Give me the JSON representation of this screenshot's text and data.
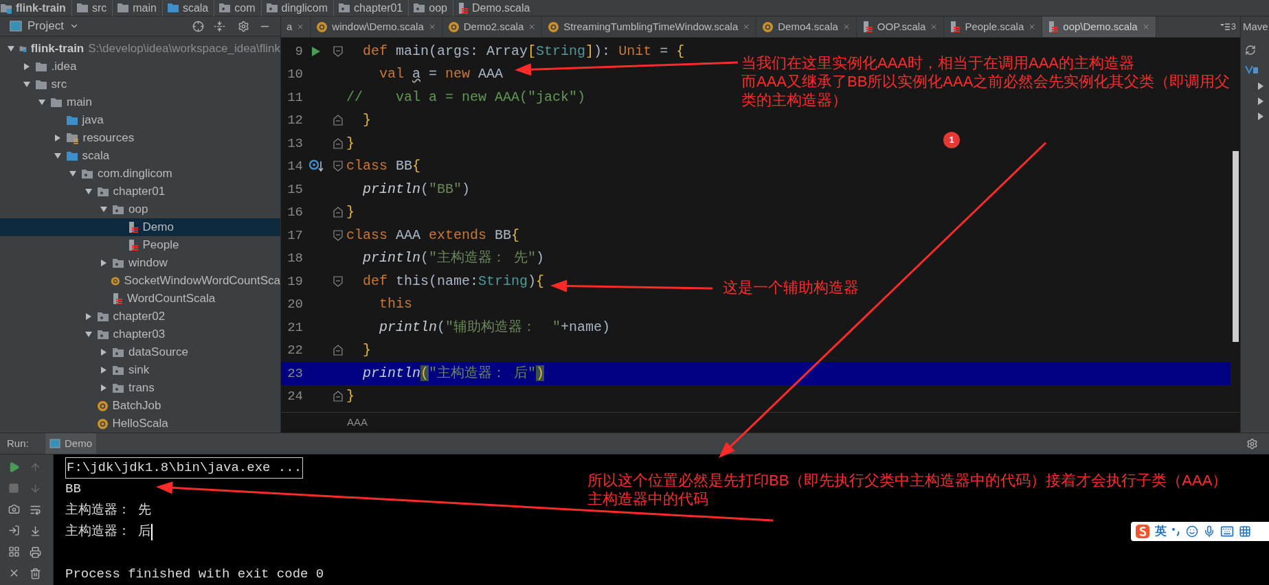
{
  "breadcrumb": [
    {
      "text": "flink-train",
      "kind": "project"
    },
    {
      "text": "src",
      "kind": "folder"
    },
    {
      "text": "main",
      "kind": "folder"
    },
    {
      "text": "scala",
      "kind": "source"
    },
    {
      "text": "com",
      "kind": "package"
    },
    {
      "text": "dinglicom",
      "kind": "package"
    },
    {
      "text": "chapter01",
      "kind": "package"
    },
    {
      "text": "oop",
      "kind": "package"
    },
    {
      "text": "Demo.scala",
      "kind": "class"
    }
  ],
  "project_panel": {
    "title": "Project"
  },
  "tree": [
    {
      "name": "flink-train",
      "path": "S:\\develop\\idea\\workspace_idea\\flink",
      "kind": "project",
      "expanded": true,
      "selected": false,
      "children": [
        {
          "name": ".idea",
          "kind": "folder",
          "expanded": false,
          "selected": false
        },
        {
          "name": "src",
          "kind": "folder",
          "expanded": true,
          "selected": false,
          "children": [
            {
              "name": "main",
              "kind": "folder",
              "expanded": true,
              "selected": false,
              "children": [
                {
                  "name": "java",
                  "kind": "source",
                  "selected": false
                },
                {
                  "name": "resources",
                  "kind": "resources",
                  "expanded": false,
                  "selected": false
                },
                {
                  "name": "scala",
                  "kind": "source",
                  "expanded": true,
                  "selected": false,
                  "children": [
                    {
                      "name": "com.dinglicom",
                      "kind": "package",
                      "expanded": true,
                      "selected": false,
                      "children": [
                        {
                          "name": "chapter01",
                          "kind": "package",
                          "expanded": true,
                          "selected": false,
                          "children": [
                            {
                              "name": "oop",
                              "kind": "package",
                              "expanded": true,
                              "selected": false,
                              "children": [
                                {
                                  "name": "Demo",
                                  "kind": "class",
                                  "selected": true
                                },
                                {
                                  "name": "People",
                                  "kind": "class",
                                  "selected": false
                                }
                              ]
                            },
                            {
                              "name": "window",
                              "kind": "package",
                              "expanded": false,
                              "selected": false
                            },
                            {
                              "name": "SocketWindowWordCountSca",
                              "kind": "object",
                              "selected": false
                            },
                            {
                              "name": "WordCountScala",
                              "kind": "class",
                              "selected": false
                            }
                          ]
                        },
                        {
                          "name": "chapter02",
                          "kind": "package",
                          "expanded": false,
                          "selected": false
                        },
                        {
                          "name": "chapter03",
                          "kind": "package",
                          "expanded": true,
                          "selected": false,
                          "children": [
                            {
                              "name": "dataSource",
                              "kind": "package",
                              "expanded": false,
                              "selected": false
                            },
                            {
                              "name": "sink",
                              "kind": "package",
                              "expanded": false,
                              "selected": false
                            },
                            {
                              "name": "trans",
                              "kind": "package",
                              "expanded": false,
                              "selected": false
                            }
                          ]
                        },
                        {
                          "name": "BatchJob",
                          "kind": "object",
                          "selected": false
                        },
                        {
                          "name": "HelloScala",
                          "kind": "object",
                          "selected": false
                        }
                      ]
                    }
                  ]
                }
              ]
            }
          ]
        }
      ]
    }
  ],
  "tabs": [
    {
      "label": "a",
      "kind": "cut",
      "selected": false
    },
    {
      "label": "window\\Demo.scala",
      "kind": "object",
      "selected": false
    },
    {
      "label": "Demo2.scala",
      "kind": "object",
      "selected": false
    },
    {
      "label": "StreamingTumblingTimeWindow.scala",
      "kind": "object",
      "selected": false
    },
    {
      "label": "Demo4.scala",
      "kind": "object",
      "selected": false
    },
    {
      "label": "OOP.scala",
      "kind": "class",
      "selected": false
    },
    {
      "label": "People.scala",
      "kind": "class",
      "selected": false
    },
    {
      "label": "oop\\Demo.scala",
      "kind": "class",
      "selected": true
    }
  ],
  "tab_overflow": "3",
  "code": [
    {
      "number": "9",
      "kind": "entry",
      "highlighted": false,
      "tokens": [
        {
          "text": "  def",
          "kind": "keyword"
        },
        {
          "text": " main(args: Array",
          "kind": "plain"
        },
        {
          "text": "[",
          "kind": "brace"
        },
        {
          "text": "String",
          "kind": "type"
        },
        {
          "text": "]",
          "kind": "brace"
        },
        {
          "text": "): ",
          "kind": "plain"
        },
        {
          "text": "Unit",
          "kind": "keyword"
        },
        {
          "text": " = ",
          "kind": "plain"
        },
        {
          "text": "{",
          "kind": "brace"
        }
      ]
    },
    {
      "number": "10",
      "kind": "code",
      "highlighted": false,
      "tokens": [
        {
          "text": "    val ",
          "kind": "keyword"
        },
        {
          "text": "a",
          "kind": "warn"
        },
        {
          "text": " = ",
          "kind": "plain"
        },
        {
          "text": "new",
          "kind": "keyword"
        },
        {
          "text": " AAA",
          "kind": "plain"
        }
      ]
    },
    {
      "number": "11",
      "kind": "code",
      "highlighted": false,
      "tokens": [
        {
          "text": "//    val a = new AAA(\"jack\")",
          "kind": "comment"
        }
      ]
    },
    {
      "number": "12",
      "kind": "code",
      "highlighted": false,
      "tokens": [
        {
          "text": "  }",
          "kind": "brace"
        }
      ]
    },
    {
      "number": "13",
      "kind": "code",
      "highlighted": false,
      "tokens": [
        {
          "text": "}",
          "kind": "brace"
        }
      ]
    },
    {
      "number": "14",
      "kind": "overridden",
      "highlighted": false,
      "tokens": [
        {
          "text": "class",
          "kind": "keyword"
        },
        {
          "text": " BB",
          "kind": "plain"
        },
        {
          "text": "{",
          "kind": "brace"
        }
      ]
    },
    {
      "number": "15",
      "kind": "code",
      "highlighted": false,
      "tokens": [
        {
          "text": "  println",
          "kind": "call"
        },
        {
          "text": "(",
          "kind": "plain"
        },
        {
          "text": "\"BB\"",
          "kind": "string"
        },
        {
          "text": ")",
          "kind": "plain"
        }
      ]
    },
    {
      "number": "16",
      "kind": "code",
      "highlighted": false,
      "tokens": [
        {
          "text": "}",
          "kind": "brace"
        }
      ]
    },
    {
      "number": "17",
      "kind": "code",
      "highlighted": false,
      "tokens": [
        {
          "text": "class",
          "kind": "keyword"
        },
        {
          "text": " AAA ",
          "kind": "plain"
        },
        {
          "text": "extends",
          "kind": "keyword"
        },
        {
          "text": " BB",
          "kind": "plain"
        },
        {
          "text": "{",
          "kind": "brace"
        }
      ]
    },
    {
      "number": "18",
      "kind": "code",
      "highlighted": false,
      "tokens": [
        {
          "text": "  println",
          "kind": "call"
        },
        {
          "text": "(",
          "kind": "plain"
        },
        {
          "text": "\"主构造器： 先\"",
          "kind": "string"
        },
        {
          "text": ")",
          "kind": "plain"
        }
      ]
    },
    {
      "number": "19",
      "kind": "code",
      "highlighted": false,
      "tokens": [
        {
          "text": "  def",
          "kind": "keyword"
        },
        {
          "text": " this(name:",
          "kind": "plain"
        },
        {
          "text": "String",
          "kind": "type"
        },
        {
          "text": ")",
          "kind": "plain"
        },
        {
          "text": "{",
          "kind": "brace"
        }
      ]
    },
    {
      "number": "20",
      "kind": "code",
      "highlighted": false,
      "tokens": [
        {
          "text": "    this",
          "kind": "keyword"
        }
      ]
    },
    {
      "number": "21",
      "kind": "code",
      "highlighted": false,
      "tokens": [
        {
          "text": "    println",
          "kind": "call"
        },
        {
          "text": "(",
          "kind": "plain"
        },
        {
          "text": "\"辅助构造器：  \"",
          "kind": "string"
        },
        {
          "text": "+name)",
          "kind": "plain"
        }
      ]
    },
    {
      "number": "22",
      "kind": "code",
      "highlighted": false,
      "tokens": [
        {
          "text": "  }",
          "kind": "brace"
        }
      ]
    },
    {
      "number": "23",
      "kind": "code",
      "highlighted": true,
      "tokens": [
        {
          "text": "  println",
          "kind": "call"
        },
        {
          "text": "(",
          "kind": "match"
        },
        {
          "text": "\"主构造器： 后\"",
          "kind": "string"
        },
        {
          "text": ")",
          "kind": "match"
        }
      ]
    },
    {
      "number": "24",
      "kind": "code",
      "highlighted": false,
      "tokens": [
        {
          "text": "}",
          "kind": "brace"
        }
      ]
    }
  ],
  "editor_breadcrumb": "AAA",
  "maven": {
    "label": "Mave"
  },
  "run_panel": {
    "label": "Run:",
    "tab": "Demo"
  },
  "console": [
    {
      "text": "F:\\jdk\\jdk1.8\\bin\\java.exe ...",
      "kind": "command",
      "cursor": false
    },
    {
      "text": "BB",
      "kind": "output",
      "cursor": false
    },
    {
      "text": "主构造器： 先",
      "kind": "output",
      "cursor": false
    },
    {
      "text": "主构造器： 后",
      "kind": "output",
      "cursor": true
    },
    {
      "text": "Process finished with exit code 0",
      "kind": "exit",
      "cursor": false
    }
  ],
  "annotations": [
    {
      "lines": [
        "当我们在这里实例化AAA时，相当于在调用AAA的主构造器",
        "而AAA又继承了BB所以实例化AAA之前必然会先实例化其父类（即调用父",
        "类的主构造器）"
      ]
    },
    {
      "lines": [
        "这是一个辅助构造器"
      ]
    },
    {
      "lines": [
        "所以这个位置必然是先打印BB（即先执行父类中主构造器中的代码）接着才会执行子类（AAA）",
        "主构造器中的代码"
      ]
    }
  ],
  "marker_badge": "1",
  "ime": {
    "mode": "英"
  }
}
